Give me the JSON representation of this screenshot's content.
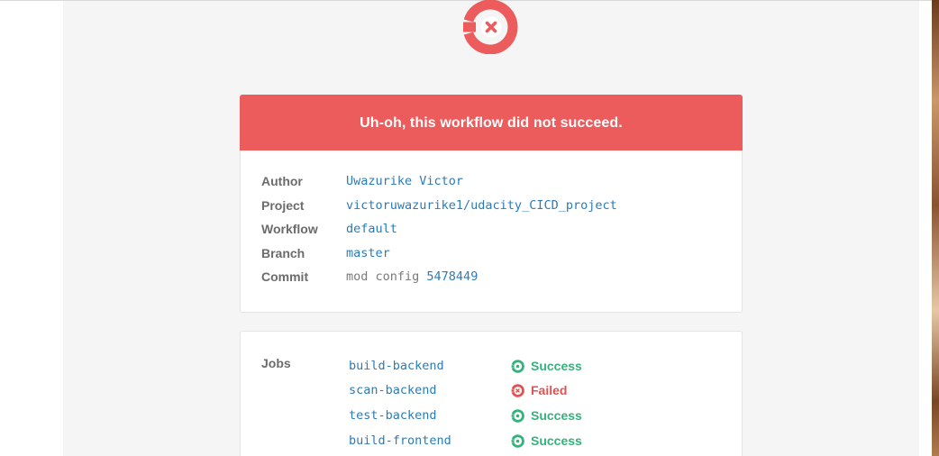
{
  "colors": {
    "brand_red": "#ed5c5c",
    "link_blue": "#2c7bb6",
    "label_gray": "#6b6b6b",
    "success_green": "#34b27b",
    "failed_red": "#e05252",
    "background": "#f5f5f5"
  },
  "header": {
    "logo_icon": "circleci-failed-logo-icon"
  },
  "banner": {
    "message": "Uh-oh, this workflow did not succeed."
  },
  "details": {
    "author_label": "Author",
    "author_value": "Uwazurike Victor",
    "project_label": "Project",
    "project_value": "victoruwazurike1/udacity_CICD_project",
    "workflow_label": "Workflow",
    "workflow_value": "default",
    "branch_label": "Branch",
    "branch_value": "master",
    "commit_label": "Commit",
    "commit_message": "mod config",
    "commit_hash": "5478449"
  },
  "jobs": {
    "label": "Jobs",
    "items": [
      {
        "name": "build-backend",
        "status": "Success",
        "icon": "success-icon"
      },
      {
        "name": "scan-backend",
        "status": "Failed",
        "icon": "failed-icon"
      },
      {
        "name": "test-backend",
        "status": "Success",
        "icon": "success-icon"
      },
      {
        "name": "build-frontend",
        "status": "Success",
        "icon": "success-icon"
      }
    ]
  }
}
